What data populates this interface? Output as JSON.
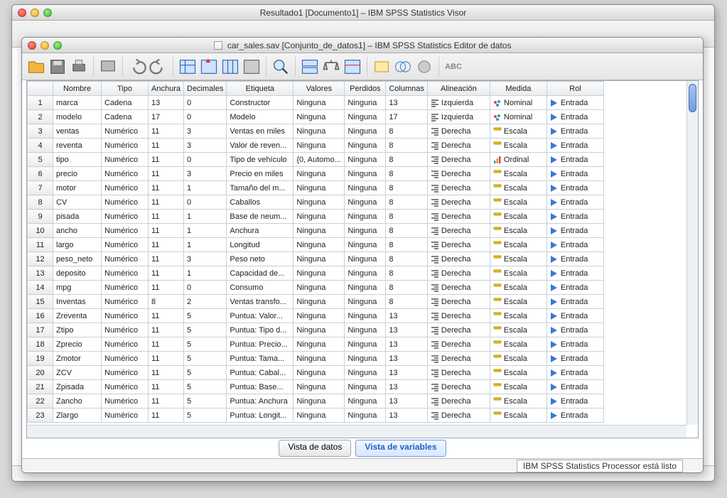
{
  "back_window": {
    "title": "Resultado1 [Documento1] – IBM SPSS Statistics Visor"
  },
  "front_window": {
    "filename": "car_sales.sav",
    "title_suffix": "[Conjunto_de_datos1] – IBM SPSS Statistics Editor de datos"
  },
  "columns": [
    "Nombre",
    "Tipo",
    "Anchura",
    "Decimales",
    "Etiqueta",
    "Valores",
    "Perdidos",
    "Columnas",
    "Alineación",
    "Medida",
    "Rol"
  ],
  "alignment_labels": {
    "left": "Izquierda",
    "right": "Derecha"
  },
  "measure_labels": {
    "nominal": "Nominal",
    "ordinal": "Ordinal",
    "scale": "Escala"
  },
  "role_labels": {
    "input": "Entrada"
  },
  "rows": [
    {
      "n": 1,
      "nombre": "marca",
      "tipo": "Cadena",
      "anch": "13",
      "dec": "0",
      "etiq": "Constructor",
      "val": "Ninguna",
      "perd": "Ninguna",
      "cols": "13",
      "ali": "left",
      "med": "nominal",
      "rol": "input"
    },
    {
      "n": 2,
      "nombre": "modelo",
      "tipo": "Cadena",
      "anch": "17",
      "dec": "0",
      "etiq": "Modelo",
      "val": "Ninguna",
      "perd": "Ninguna",
      "cols": "17",
      "ali": "left",
      "med": "nominal",
      "rol": "input"
    },
    {
      "n": 3,
      "nombre": "ventas",
      "tipo": "Numérico",
      "anch": "11",
      "dec": "3",
      "etiq": "Ventas en miles",
      "val": "Ninguna",
      "perd": "Ninguna",
      "cols": "8",
      "ali": "right",
      "med": "scale",
      "rol": "input"
    },
    {
      "n": 4,
      "nombre": "reventa",
      "tipo": "Numérico",
      "anch": "11",
      "dec": "3",
      "etiq": "Valor de reven...",
      "val": "Ninguna",
      "perd": "Ninguna",
      "cols": "8",
      "ali": "right",
      "med": "scale",
      "rol": "input"
    },
    {
      "n": 5,
      "nombre": "tipo",
      "tipo": "Numérico",
      "anch": "11",
      "dec": "0",
      "etiq": "Tipo de vehículo",
      "val": "{0, Automo...",
      "perd": "Ninguna",
      "cols": "8",
      "ali": "right",
      "med": "ordinal",
      "rol": "input"
    },
    {
      "n": 6,
      "nombre": "precio",
      "tipo": "Numérico",
      "anch": "11",
      "dec": "3",
      "etiq": "Precio en miles",
      "val": "Ninguna",
      "perd": "Ninguna",
      "cols": "8",
      "ali": "right",
      "med": "scale",
      "rol": "input"
    },
    {
      "n": 7,
      "nombre": "motor",
      "tipo": "Numérico",
      "anch": "11",
      "dec": "1",
      "etiq": "Tamaño del m...",
      "val": "Ninguna",
      "perd": "Ninguna",
      "cols": "8",
      "ali": "right",
      "med": "scale",
      "rol": "input"
    },
    {
      "n": 8,
      "nombre": "CV",
      "tipo": "Numérico",
      "anch": "11",
      "dec": "0",
      "etiq": "Caballos",
      "val": "Ninguna",
      "perd": "Ninguna",
      "cols": "8",
      "ali": "right",
      "med": "scale",
      "rol": "input"
    },
    {
      "n": 9,
      "nombre": "pisada",
      "tipo": "Numérico",
      "anch": "11",
      "dec": "1",
      "etiq": "Base de neum...",
      "val": "Ninguna",
      "perd": "Ninguna",
      "cols": "8",
      "ali": "right",
      "med": "scale",
      "rol": "input"
    },
    {
      "n": 10,
      "nombre": "ancho",
      "tipo": "Numérico",
      "anch": "11",
      "dec": "1",
      "etiq": "Anchura",
      "val": "Ninguna",
      "perd": "Ninguna",
      "cols": "8",
      "ali": "right",
      "med": "scale",
      "rol": "input"
    },
    {
      "n": 11,
      "nombre": "largo",
      "tipo": "Numérico",
      "anch": "11",
      "dec": "1",
      "etiq": "Longitud",
      "val": "Ninguna",
      "perd": "Ninguna",
      "cols": "8",
      "ali": "right",
      "med": "scale",
      "rol": "input"
    },
    {
      "n": 12,
      "nombre": "peso_neto",
      "tipo": "Numérico",
      "anch": "11",
      "dec": "3",
      "etiq": "Peso neto",
      "val": "Ninguna",
      "perd": "Ninguna",
      "cols": "8",
      "ali": "right",
      "med": "scale",
      "rol": "input"
    },
    {
      "n": 13,
      "nombre": "deposito",
      "tipo": "Numérico",
      "anch": "11",
      "dec": "1",
      "etiq": "Capacidad de...",
      "val": "Ninguna",
      "perd": "Ninguna",
      "cols": "8",
      "ali": "right",
      "med": "scale",
      "rol": "input"
    },
    {
      "n": 14,
      "nombre": "mpg",
      "tipo": "Numérico",
      "anch": "11",
      "dec": "0",
      "etiq": "Consumo",
      "val": "Ninguna",
      "perd": "Ninguna",
      "cols": "8",
      "ali": "right",
      "med": "scale",
      "rol": "input"
    },
    {
      "n": 15,
      "nombre": "Inventas",
      "tipo": "Numérico",
      "anch": "8",
      "dec": "2",
      "etiq": "Ventas transfo...",
      "val": "Ninguna",
      "perd": "Ninguna",
      "cols": "8",
      "ali": "right",
      "med": "scale",
      "rol": "input"
    },
    {
      "n": 16,
      "nombre": "Zreventa",
      "tipo": "Numérico",
      "anch": "11",
      "dec": "5",
      "etiq": "Puntua:  Valor...",
      "val": "Ninguna",
      "perd": "Ninguna",
      "cols": "13",
      "ali": "right",
      "med": "scale",
      "rol": "input"
    },
    {
      "n": 17,
      "nombre": "Ztipo",
      "tipo": "Numérico",
      "anch": "11",
      "dec": "5",
      "etiq": "Puntua:  Tipo d...",
      "val": "Ninguna",
      "perd": "Ninguna",
      "cols": "13",
      "ali": "right",
      "med": "scale",
      "rol": "input"
    },
    {
      "n": 18,
      "nombre": "Zprecio",
      "tipo": "Numérico",
      "anch": "11",
      "dec": "5",
      "etiq": "Puntua:  Precio...",
      "val": "Ninguna",
      "perd": "Ninguna",
      "cols": "13",
      "ali": "right",
      "med": "scale",
      "rol": "input"
    },
    {
      "n": 19,
      "nombre": "Zmotor",
      "tipo": "Numérico",
      "anch": "11",
      "dec": "5",
      "etiq": "Puntua:  Tama...",
      "val": "Ninguna",
      "perd": "Ninguna",
      "cols": "13",
      "ali": "right",
      "med": "scale",
      "rol": "input"
    },
    {
      "n": 20,
      "nombre": "ZCV",
      "tipo": "Numérico",
      "anch": "11",
      "dec": "5",
      "etiq": "Puntua:  Cabal...",
      "val": "Ninguna",
      "perd": "Ninguna",
      "cols": "13",
      "ali": "right",
      "med": "scale",
      "rol": "input"
    },
    {
      "n": 21,
      "nombre": "Zpisada",
      "tipo": "Numérico",
      "anch": "11",
      "dec": "5",
      "etiq": "Puntua:  Base...",
      "val": "Ninguna",
      "perd": "Ninguna",
      "cols": "13",
      "ali": "right",
      "med": "scale",
      "rol": "input"
    },
    {
      "n": 22,
      "nombre": "Zancho",
      "tipo": "Numérico",
      "anch": "11",
      "dec": "5",
      "etiq": "Puntua: Anchura",
      "val": "Ninguna",
      "perd": "Ninguna",
      "cols": "13",
      "ali": "right",
      "med": "scale",
      "rol": "input"
    },
    {
      "n": 23,
      "nombre": "Zlargo",
      "tipo": "Numérico",
      "anch": "11",
      "dec": "5",
      "etiq": "Puntua:  Longit...",
      "val": "Ninguna",
      "perd": "Ninguna",
      "cols": "13",
      "ali": "right",
      "med": "scale",
      "rol": "input"
    }
  ],
  "tabs": {
    "data": "Vista de datos",
    "vars": "Vista de variables"
  },
  "status": "IBM SPSS Statistics Processor está listo"
}
